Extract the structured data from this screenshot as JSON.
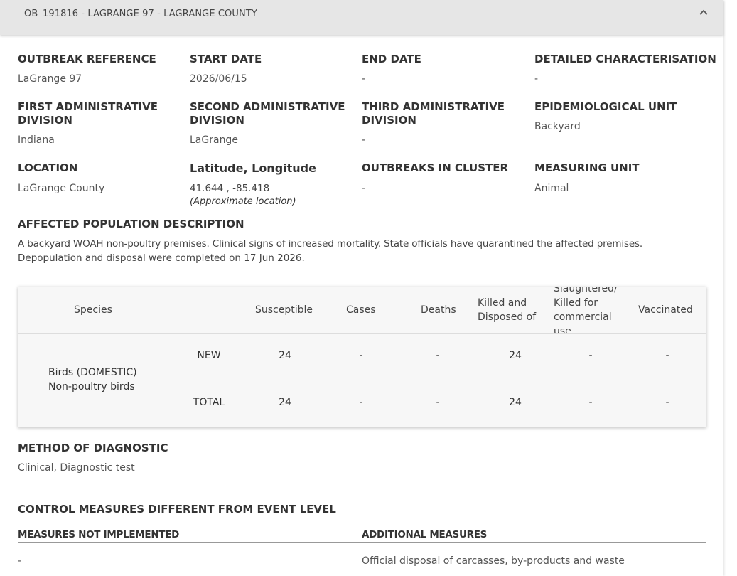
{
  "header": {
    "title": "OB_191816 - LAGRANGE 97 - LAGRANGE COUNTY",
    "toggle_icon": "chevron-up-icon"
  },
  "fields": {
    "outbreak_reference": {
      "label": "OUTBREAK REFERENCE",
      "value": "LaGrange 97"
    },
    "start_date": {
      "label": "START DATE",
      "value": "2026/06/15"
    },
    "end_date": {
      "label": "END DATE",
      "value": "-"
    },
    "detailed_characterisation": {
      "label": "DETAILED CHARACTERISATION",
      "value": "-"
    },
    "first_admin_division": {
      "label_line1": "FIRST ADMINISTRATIVE",
      "label_line2": "DIVISION",
      "value": "Indiana"
    },
    "second_admin_division": {
      "label_line1": "SECOND ADMINISTRATIVE",
      "label_line2": "DIVISION",
      "value": "LaGrange"
    },
    "third_admin_division": {
      "label_line1": "THIRD ADMINISTRATIVE",
      "label_line2": "DIVISION",
      "value": "-"
    },
    "epidemiological_unit": {
      "label": "EPIDEMIOLOGICAL UNIT",
      "value": "Backyard"
    },
    "location": {
      "label": "LOCATION",
      "value": "LaGrange County"
    },
    "lat_long": {
      "label": "Latitude, Longitude",
      "value": "41.644 , -85.418",
      "note": "(Approximate location)"
    },
    "outbreaks_in_cluster": {
      "label": "OUTBREAKS IN CLUSTER",
      "value": "-"
    },
    "measuring_unit": {
      "label": "MEASURING UNIT",
      "value": "Animal"
    }
  },
  "affected_population": {
    "label": "AFFECTED POPULATION DESCRIPTION",
    "line1": "A backyard WOAH non-poultry premises. Clinical signs of increased mortality. State officials have quarantined the affected premises.",
    "line2": "Depopulation and disposal were completed on 17 Jun 2026."
  },
  "table": {
    "headers": {
      "species": "Species",
      "susceptible": "Susceptible",
      "cases": "Cases",
      "deaths": "Deaths",
      "killed_line1": "Killed and",
      "killed_line2": "Disposed of",
      "slaughtered_line1": "Slaughtered/",
      "slaughtered_line2": "Killed for",
      "slaughtered_line3": "commercial",
      "slaughtered_line4": "use",
      "vaccinated": "Vaccinated"
    },
    "species_line1": "Birds (DOMESTIC)",
    "species_line2": "Non-poultry birds",
    "rows": [
      {
        "label": "NEW",
        "susceptible": "24",
        "cases": "-",
        "deaths": "-",
        "killed": "24",
        "slaughtered": "-",
        "vaccinated": "-"
      },
      {
        "label": "TOTAL",
        "susceptible": "24",
        "cases": "-",
        "deaths": "-",
        "killed": "24",
        "slaughtered": "-",
        "vaccinated": "-"
      }
    ]
  },
  "diagnostic": {
    "label": "METHOD OF DIAGNOSTIC",
    "value": "Clinical, Diagnostic test"
  },
  "control_measures": {
    "label": "CONTROL MEASURES DIFFERENT FROM EVENT LEVEL",
    "not_implemented_label": "MEASURES NOT IMPLEMENTED",
    "not_implemented_value": "-",
    "additional_label": "ADDITIONAL MEASURES",
    "additional_value": "Official disposal of carcasses, by-products and waste"
  }
}
